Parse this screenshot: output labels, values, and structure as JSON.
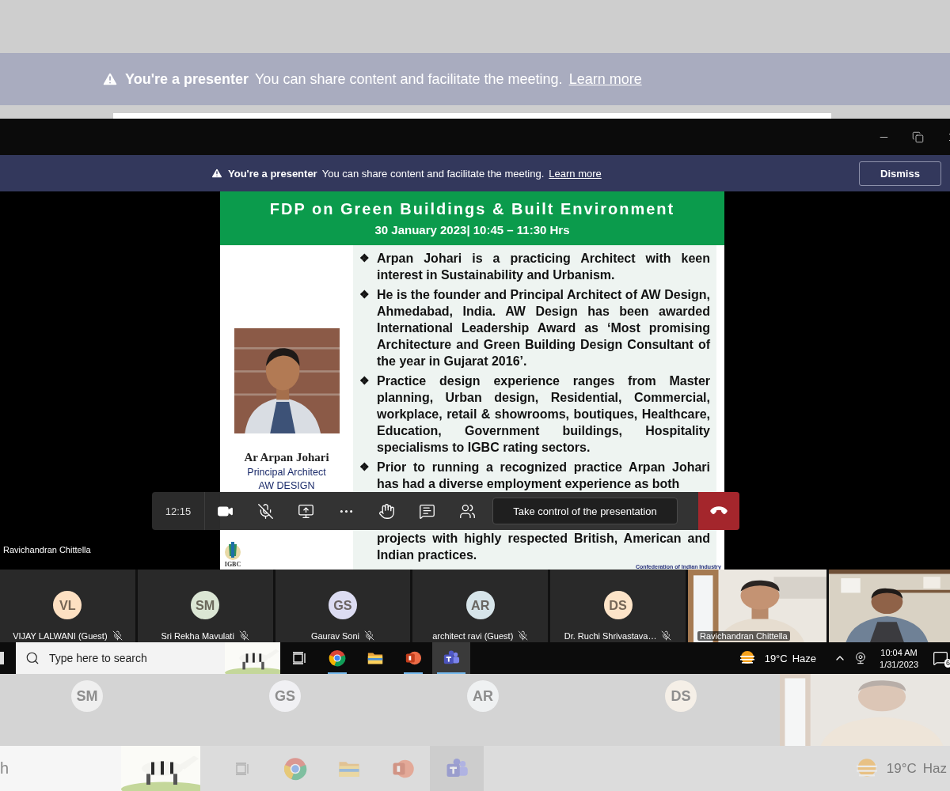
{
  "background_top": {
    "banner": {
      "title": "You're a presenter",
      "message": "You can share content and facilitate the meeting.",
      "link": "Learn more"
    }
  },
  "banner": {
    "title": "You're a presenter",
    "message": "You can share content and facilitate the meeting.",
    "link": "Learn more",
    "button": "Dismiss"
  },
  "slide": {
    "title": "FDP on Green Buildings & Built Environment",
    "subtitle": "30 January 2023| 10:45 – 11:30 Hrs",
    "speaker": {
      "name": "Ar Arpan Johari",
      "role": "Principal Architect",
      "company": "AW DESIGN"
    },
    "bullets": [
      {
        "marker": "❖",
        "text": "Arpan Johari is a practicing Architect with keen interest in Sustainability and Urbanism."
      },
      {
        "marker": "❖",
        "text": "He is the founder and Principal Architect of AW Design, Ahmedabad, India. AW Design has been awarded International Leadership Award as ‘Most promising Architecture and Green Building Design Consultant of the year in Gujarat 2016’."
      },
      {
        "marker": "❖",
        "text": "Practice design experience ranges from Master planning, Urban design, Residential, Commercial, workplace, retail & showrooms, boutiques, Healthcare, Education, Government buildings, Hospitality specialisms to IGBC rating sectors."
      },
      {
        "marker": "❖",
        "text": "Prior to running a recognized practice Arpan Johari has had a diverse employment experience as both",
        "continuation": "projects with highly respected British, American and Indian practices."
      }
    ],
    "logo_text": "IGBC",
    "footer": "Confederation of Indian Industry"
  },
  "stage_label": "Ravichandran Chittella",
  "controls": {
    "timer": "12:15",
    "take_control": "Take control of the presentation"
  },
  "participants": [
    {
      "kind": "avatar",
      "initials": "VL",
      "name": "VIJAY LALWANI (Guest)",
      "color": "#fde0c2",
      "muted": true
    },
    {
      "kind": "avatar",
      "initials": "SM",
      "name": "Sri Rekha Mavulati",
      "color": "#dbe6d4",
      "muted": true
    },
    {
      "kind": "avatar",
      "initials": "GS",
      "name": "Gaurav Soni",
      "color": "#dcdcf2",
      "muted": true
    },
    {
      "kind": "avatar",
      "initials": "AR",
      "name": "architect ravi (Guest)",
      "color": "#d7e5ea",
      "muted": true
    },
    {
      "kind": "avatar",
      "initials": "DS",
      "name": "Dr. Ruchi Shrivastava…",
      "color": "#fde4c8",
      "muted": true
    },
    {
      "kind": "video",
      "name": "Ravichandran Chittella"
    },
    {
      "kind": "video"
    }
  ],
  "taskbar": {
    "search_placeholder": "Type here to search",
    "apps": [
      {
        "kind": "browser",
        "open": true,
        "selected": false
      },
      {
        "kind": "folder",
        "open": false,
        "selected": false
      },
      {
        "kind": "slides",
        "open": true,
        "selected": false
      },
      {
        "kind": "teams",
        "open": true,
        "selected": true
      }
    ],
    "weather": "19°C",
    "weather_text": "Haze",
    "time": "10:04 AM",
    "date": "1/31/2023",
    "notifications": "6"
  },
  "background_bottom": {
    "participants": [
      {
        "initials": "SM",
        "color": "#efefef"
      },
      {
        "initials": "GS",
        "color": "#f0f0f3"
      },
      {
        "initials": "AR",
        "color": "#eff1f2"
      },
      {
        "initials": "DS",
        "color": "#f5efe7"
      }
    ],
    "search_fragment": "h",
    "weather": "19°C",
    "weather_text": "Haz",
    "apps": [
      {
        "kind": "browser",
        "selected": false
      },
      {
        "kind": "folder",
        "selected": false
      },
      {
        "kind": "slides",
        "selected": false
      },
      {
        "kind": "teams",
        "selected": true
      }
    ]
  }
}
